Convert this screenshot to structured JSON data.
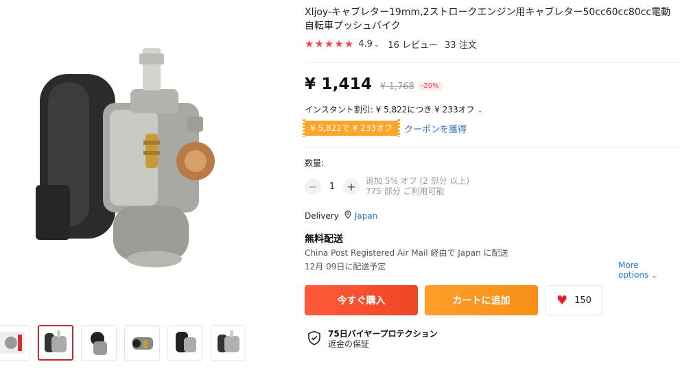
{
  "product": {
    "title": "Xljoy-キャブレター19mm,2ストロークエンジン用キャブレター50cc60cc80cc電動自転車プッシュバイク",
    "rating": "4.9",
    "reviews": "16 レビュー",
    "orders": "33 注文",
    "stars": 5
  },
  "pricing": {
    "price": "¥ 1,414",
    "original_price": "¥ 1,768",
    "discount": "-20%",
    "instant_discount": "インスタント割引: ¥ 5,822につき ¥ 233オフ",
    "coupon_tag": "¥ 5,822で ¥ 233オフ",
    "coupon_link": "クーポンを獲得"
  },
  "quantity": {
    "label": "数量:",
    "value": "1",
    "extra_discount": "追加 5% オフ (2 部分 以上)",
    "available": "775 部分 ご利用可能"
  },
  "delivery": {
    "label": "Delivery",
    "country": "Japan",
    "shipping_title": "無料配送",
    "shipping_method": "China Post Registered Air Mail 経由で Japan に配送",
    "estimated": "12月 09日に配送予定",
    "more_options": "More options"
  },
  "actions": {
    "buy_now": "今すぐ購入",
    "add_to_cart": "カートに追加",
    "wishlist_count": "150"
  },
  "protection": {
    "title": "75日バイヤープロテクション",
    "subtitle": "返金の保証"
  },
  "colors": {
    "star": "#f0484e",
    "buy": "#ef4623",
    "cart": "#f78f17",
    "link": "#2e74c8",
    "coupon": "#ffa52a"
  },
  "icons": [
    "star-icon",
    "location-pin-icon",
    "heart-icon",
    "shield-check-icon",
    "chevron-down-icon",
    "minus-icon",
    "plus-icon"
  ]
}
